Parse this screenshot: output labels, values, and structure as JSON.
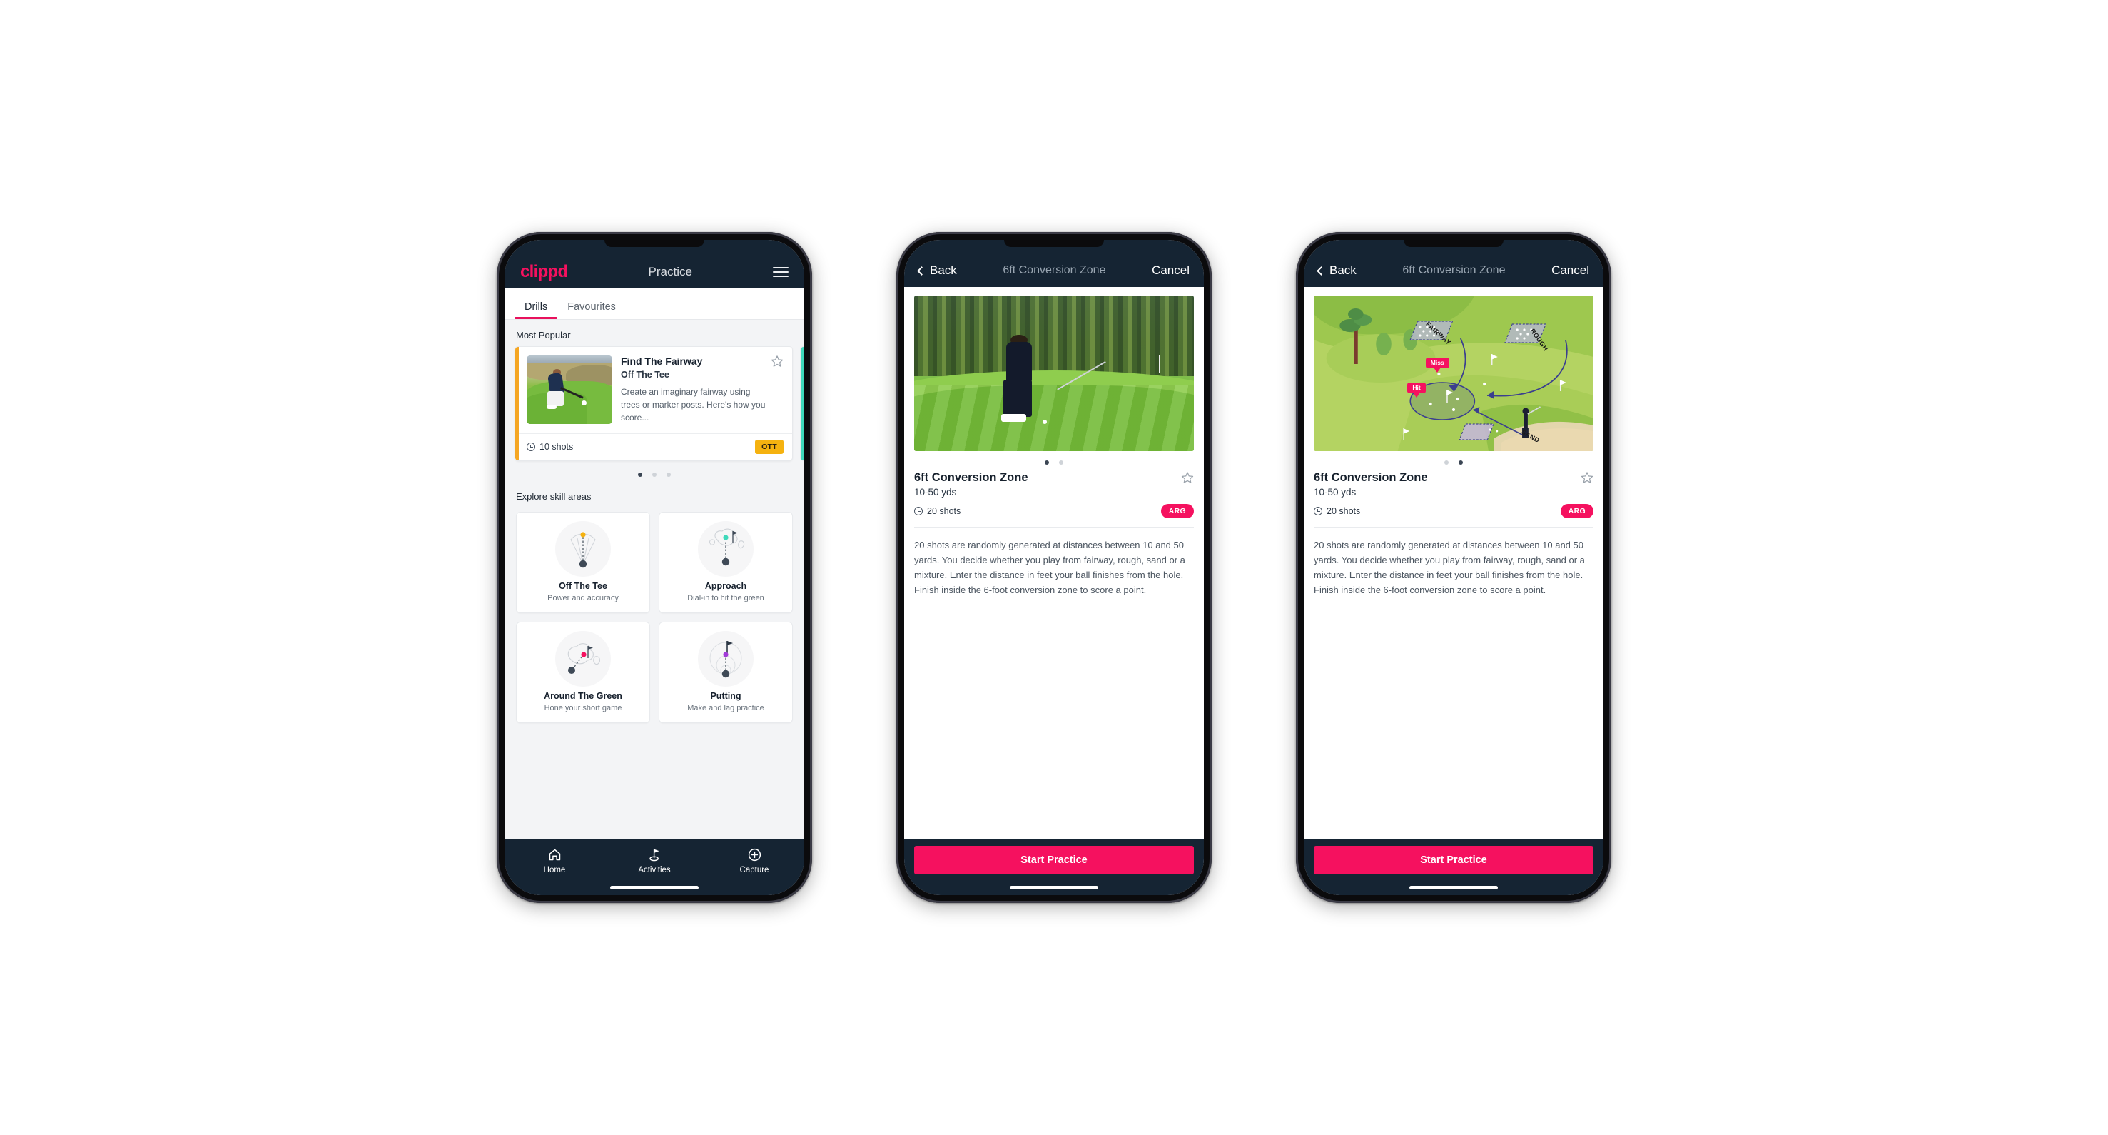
{
  "app": {
    "brand": "clippd",
    "brand_color": "#f5115f"
  },
  "phone1": {
    "topbar": {
      "title": "Practice",
      "menu_icon": "hamburger-menu-icon"
    },
    "tabs": [
      {
        "label": "Drills",
        "active": true
      },
      {
        "label": "Favourites",
        "active": false
      }
    ],
    "most_popular": {
      "section_label": "Most Popular",
      "card": {
        "title": "Find The Fairway",
        "subtitle": "Off The Tee",
        "description": "Create an imaginary fairway using trees or marker posts. Here's how you score...",
        "shots": "10 shots",
        "badge": "OTT",
        "badge_color": "#f5b210",
        "accent_color": "#f5a623",
        "favourite_icon": "star-outline-icon"
      },
      "peek_accent_color": "#3fd9bb",
      "dots": {
        "count": 3,
        "active_index": 0
      }
    },
    "explore": {
      "section_label": "Explore skill areas",
      "cards": [
        {
          "name": "Off The Tee",
          "desc": "Power and accuracy",
          "icon": "tee-shot-dispersion-icon",
          "dot_color": "#f5b210"
        },
        {
          "name": "Approach",
          "desc": "Dial-in to hit the green",
          "icon": "approach-green-icon",
          "dot_color": "#3fd9bb"
        },
        {
          "name": "Around The Green",
          "desc": "Hone your short game",
          "icon": "chip-around-green-icon",
          "dot_color": "#f5115f"
        },
        {
          "name": "Putting",
          "desc": "Make and lag practice",
          "icon": "putting-rings-icon",
          "dot_color": "#a23cd8"
        }
      ]
    },
    "tabbar": [
      {
        "label": "Home",
        "icon": "home-icon",
        "active": false
      },
      {
        "label": "Activities",
        "icon": "golf-flag-icon",
        "active": true
      },
      {
        "label": "Capture",
        "icon": "plus-circle-icon",
        "active": false
      }
    ]
  },
  "phone2": {
    "navbar": {
      "back": "Back",
      "title": "6ft Conversion Zone",
      "cancel": "Cancel",
      "back_icon": "chevron-left-icon"
    },
    "hero": {
      "type": "photo",
      "alt": "golfer-chipping-photo"
    },
    "dots": {
      "count": 2,
      "active_index": 0
    },
    "detail": {
      "title": "6ft Conversion Zone",
      "subtitle": "10-50 yds",
      "shots": "20 shots",
      "badge": "ARG",
      "badge_color": "#f5115f",
      "favourite_icon": "star-outline-icon",
      "description": "20 shots are randomly generated at distances between 10 and 50 yards. You decide whether you play from fairway, rough, sand or a mixture. Enter the distance in feet your ball finishes from the hole. Finish inside the 6-foot conversion zone to score a point."
    },
    "cta": {
      "label": "Start Practice",
      "color": "#f5115f"
    }
  },
  "phone3": {
    "navbar": {
      "back": "Back",
      "title": "6ft Conversion Zone",
      "cancel": "Cancel",
      "back_icon": "chevron-left-icon"
    },
    "hero": {
      "type": "illustration",
      "alt": "golf-green-zones-illustration",
      "zone_labels": [
        "FAIRWAY",
        "ROUGH",
        "SAND"
      ],
      "pills": [
        {
          "label": "Miss",
          "color": "#f5115f"
        },
        {
          "label": "Hit",
          "color": "#f5115f"
        }
      ]
    },
    "dots": {
      "count": 2,
      "active_index": 1
    },
    "detail": {
      "title": "6ft Conversion Zone",
      "subtitle": "10-50 yds",
      "shots": "20 shots",
      "badge": "ARG",
      "badge_color": "#f5115f",
      "favourite_icon": "star-outline-icon",
      "description": "20 shots are randomly generated at distances between 10 and 50 yards. You decide whether you play from fairway, rough, sand or a mixture. Enter the distance in feet your ball finishes from the hole. Finish inside the 6-foot conversion zone to score a point."
    },
    "cta": {
      "label": "Start Practice",
      "color": "#f5115f"
    }
  }
}
